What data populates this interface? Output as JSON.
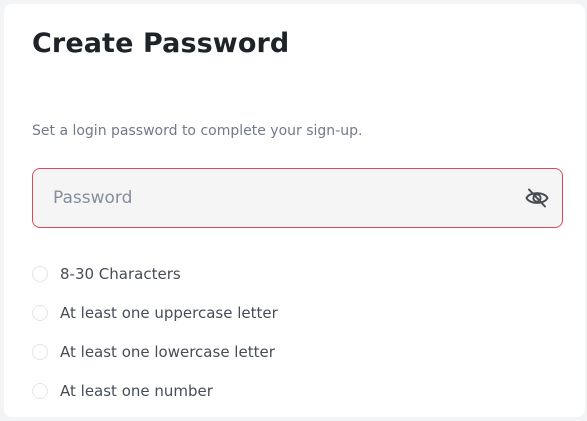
{
  "form": {
    "title": "Create Password",
    "subtitle": "Set a login password to complete your sign-up.",
    "password": {
      "value": "",
      "placeholder": "Password",
      "visibility_icon": "eye-slash-icon",
      "border_color": "#e0485a"
    },
    "requirements": [
      {
        "label": "8-30 Characters",
        "met": false
      },
      {
        "label": "At least one uppercase letter",
        "met": false
      },
      {
        "label": "At least one lowercase letter",
        "met": false
      },
      {
        "label": "At least one number",
        "met": false
      }
    ]
  }
}
